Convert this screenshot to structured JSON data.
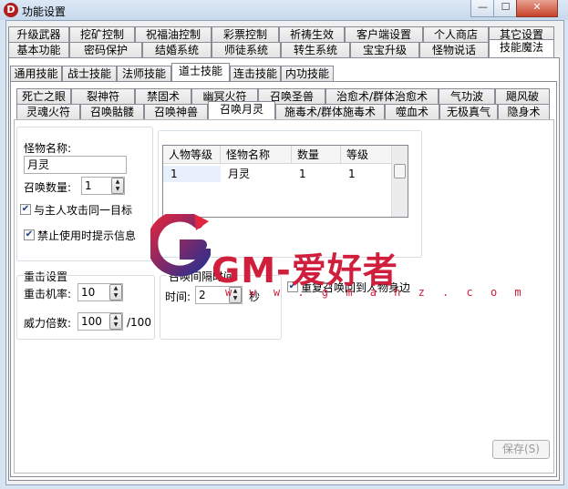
{
  "window": {
    "title": "功能设置",
    "icon_letter": "D",
    "minimize": "—",
    "maximize": "☐",
    "close": "✕"
  },
  "tabs_row1": [
    "升级武器",
    "挖矿控制",
    "祝福油控制",
    "彩票控制",
    "祈祷生效",
    "客户端设置",
    "个人商店",
    "其它设置"
  ],
  "tabs_row2": [
    "基本功能",
    "密码保护",
    "结婚系统",
    "师徒系统",
    "转生系统",
    "宝宝升级",
    "怪物说话",
    "技能魔法"
  ],
  "tabs_row2_active": "技能魔法",
  "tabs_row3": [
    "通用技能",
    "战士技能",
    "法师技能",
    "道士技能",
    "连击技能",
    "内功技能"
  ],
  "tabs_row3_active": "道士技能",
  "tabs_row4": [
    "死亡之眼",
    "裂神符",
    "禁固术",
    "幽冥火符",
    "召唤圣兽",
    "治愈术/群体治愈术",
    "气功波",
    "飓风破"
  ],
  "tabs_row5": [
    "灵魂火符",
    "召唤骷髅",
    "召唤神兽",
    "召唤月灵",
    "施毒术/群体施毒术",
    "噬血术",
    "无极真气",
    "隐身术"
  ],
  "tabs_row5_active": "召唤月灵",
  "monster": {
    "name_label": "怪物名称:",
    "name_value": "月灵",
    "count_label": "召唤数量:",
    "count_value": "1",
    "attack_same_target": "与主人攻击同一目标",
    "attack_same_target_checked": true,
    "disable_hint": "禁止使用时提示信息",
    "disable_hint_checked": true
  },
  "table": {
    "headers": [
      "人物等级",
      "怪物名称",
      "数量",
      "等级"
    ],
    "rows": [
      [
        "1",
        "月灵",
        "1",
        "1"
      ]
    ]
  },
  "crit": {
    "group_title": "重击设置",
    "rate_label": "重击机率:",
    "rate_value": "10",
    "multiplier_label": "威力倍数:",
    "multiplier_value": "100",
    "multiplier_suffix": "/100"
  },
  "interval": {
    "group_title": "召唤间隔时间",
    "time_label": "时间:",
    "time_value": "2",
    "unit": "秒"
  },
  "recall": {
    "label": "重复召唤回到人物身边",
    "checked": true
  },
  "save_label": "保存(S)",
  "watermark": {
    "text": "GM-爱好者",
    "url": "w w w . g m a h z . c o m"
  }
}
